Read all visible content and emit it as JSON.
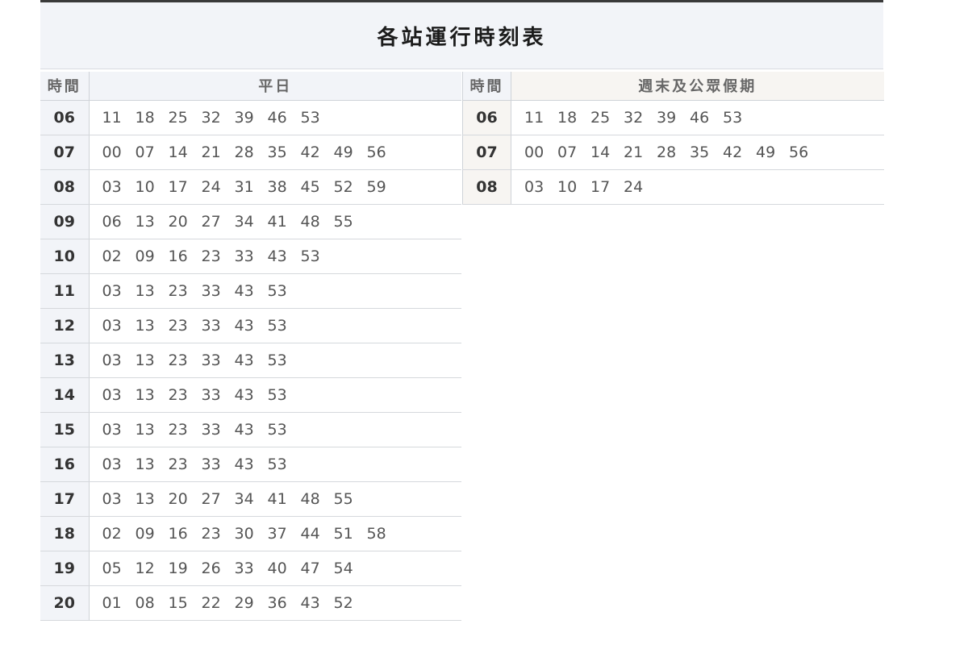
{
  "title": "各站運行時刻表",
  "weekday": {
    "hour_header": "時間",
    "title": "平日",
    "rows": [
      {
        "hour": "06",
        "minutes": [
          "11",
          "18",
          "25",
          "32",
          "39",
          "46",
          "53"
        ]
      },
      {
        "hour": "07",
        "minutes": [
          "00",
          "07",
          "14",
          "21",
          "28",
          "35",
          "42",
          "49",
          "56"
        ]
      },
      {
        "hour": "08",
        "minutes": [
          "03",
          "10",
          "17",
          "24",
          "31",
          "38",
          "45",
          "52",
          "59"
        ]
      },
      {
        "hour": "09",
        "minutes": [
          "06",
          "13",
          "20",
          "27",
          "34",
          "41",
          "48",
          "55"
        ]
      },
      {
        "hour": "10",
        "minutes": [
          "02",
          "09",
          "16",
          "23",
          "33",
          "43",
          "53"
        ]
      },
      {
        "hour": "11",
        "minutes": [
          "03",
          "13",
          "23",
          "33",
          "43",
          "53"
        ]
      },
      {
        "hour": "12",
        "minutes": [
          "03",
          "13",
          "23",
          "33",
          "43",
          "53"
        ]
      },
      {
        "hour": "13",
        "minutes": [
          "03",
          "13",
          "23",
          "33",
          "43",
          "53"
        ]
      },
      {
        "hour": "14",
        "minutes": [
          "03",
          "13",
          "23",
          "33",
          "43",
          "53"
        ]
      },
      {
        "hour": "15",
        "minutes": [
          "03",
          "13",
          "23",
          "33",
          "43",
          "53"
        ]
      },
      {
        "hour": "16",
        "minutes": [
          "03",
          "13",
          "23",
          "33",
          "43",
          "53"
        ]
      },
      {
        "hour": "17",
        "minutes": [
          "03",
          "13",
          "20",
          "27",
          "34",
          "41",
          "48",
          "55"
        ]
      },
      {
        "hour": "18",
        "minutes": [
          "02",
          "09",
          "16",
          "23",
          "30",
          "37",
          "44",
          "51",
          "58"
        ]
      },
      {
        "hour": "19",
        "minutes": [
          "05",
          "12",
          "19",
          "26",
          "33",
          "40",
          "47",
          "54"
        ]
      },
      {
        "hour": "20",
        "minutes": [
          "01",
          "08",
          "15",
          "22",
          "29",
          "36",
          "43",
          "52"
        ]
      }
    ]
  },
  "weekend": {
    "hour_header": "時間",
    "title": "週末及公眾假期",
    "rows": [
      {
        "hour": "06",
        "minutes": [
          "11",
          "18",
          "25",
          "32",
          "39",
          "46",
          "53"
        ]
      },
      {
        "hour": "07",
        "minutes": [
          "00",
          "07",
          "14",
          "21",
          "28",
          "35",
          "42",
          "49",
          "56"
        ]
      },
      {
        "hour": "08",
        "minutes": [
          "03",
          "10",
          "17",
          "24"
        ]
      }
    ]
  }
}
